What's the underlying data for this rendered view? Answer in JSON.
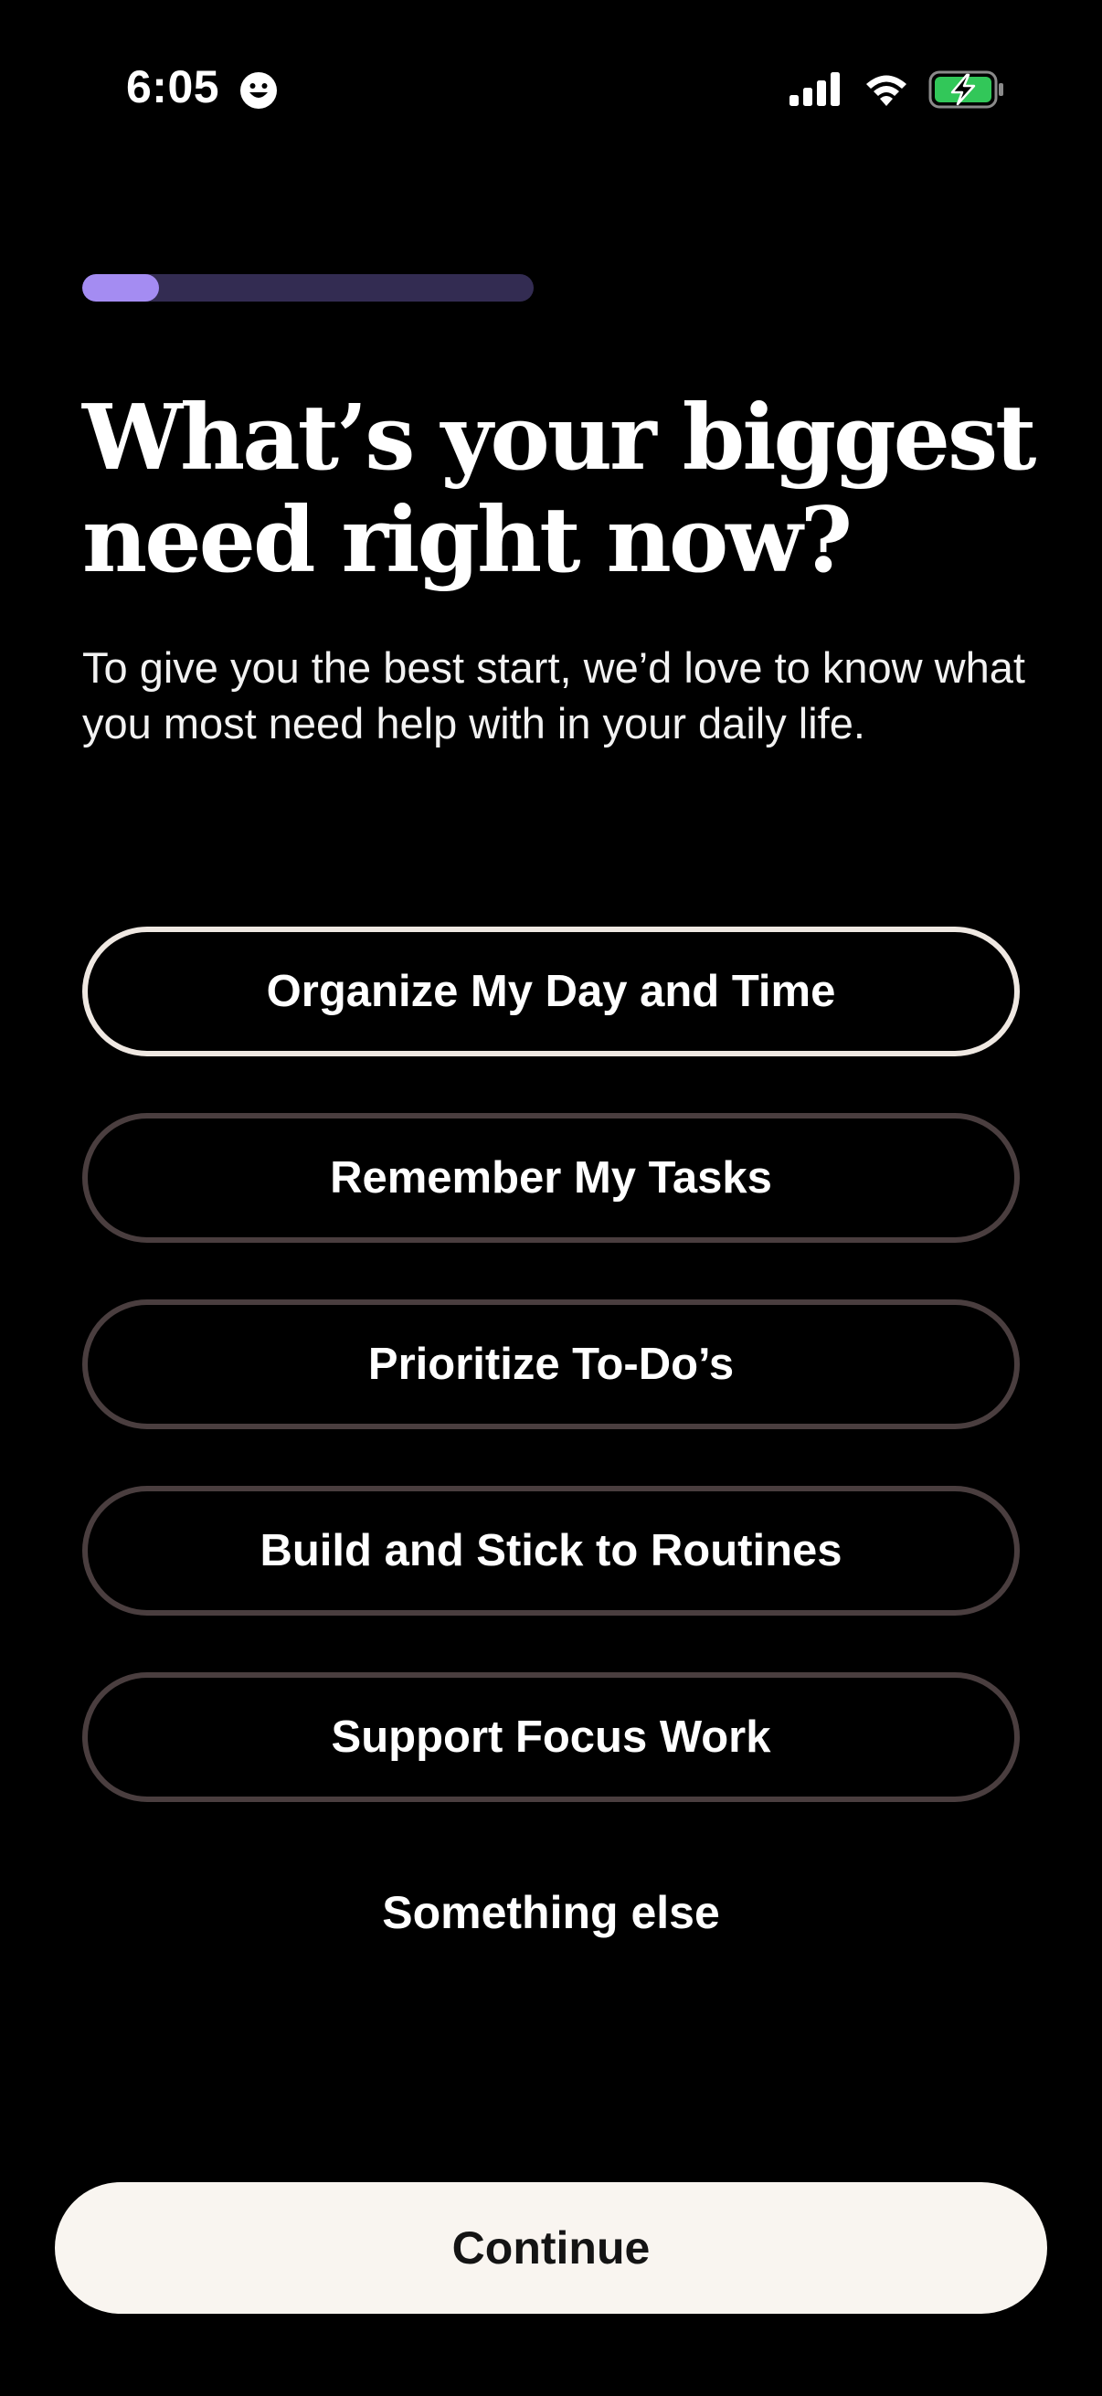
{
  "status_bar": {
    "time": "6:05",
    "icons": [
      "smiley-focus-icon",
      "cellular-signal-icon",
      "wifi-icon",
      "battery-charging-icon"
    ],
    "battery_color": "#32c759"
  },
  "progress": {
    "fraction": 0.17,
    "track_color": "#332c52",
    "fill_color": "#a48cf2"
  },
  "question": {
    "title": "What’s your biggest need right now?",
    "subtitle": "To give you the best start, we’d love to know what you most need help with in your daily life."
  },
  "options": [
    {
      "label": "Organize My Day and Time",
      "selected": true
    },
    {
      "label": "Remember My Tasks",
      "selected": false
    },
    {
      "label": "Prioritize To-Do’s",
      "selected": false
    },
    {
      "label": "Build and Stick to Routines",
      "selected": false
    },
    {
      "label": "Support Focus Work",
      "selected": false
    }
  ],
  "other_option": "Something else",
  "continue_label": "Continue",
  "colors": {
    "background": "#000000",
    "selected_border": "#efe8e2",
    "unselected_border": "#4a3e3f",
    "continue_bg": "#f9f5f0"
  }
}
